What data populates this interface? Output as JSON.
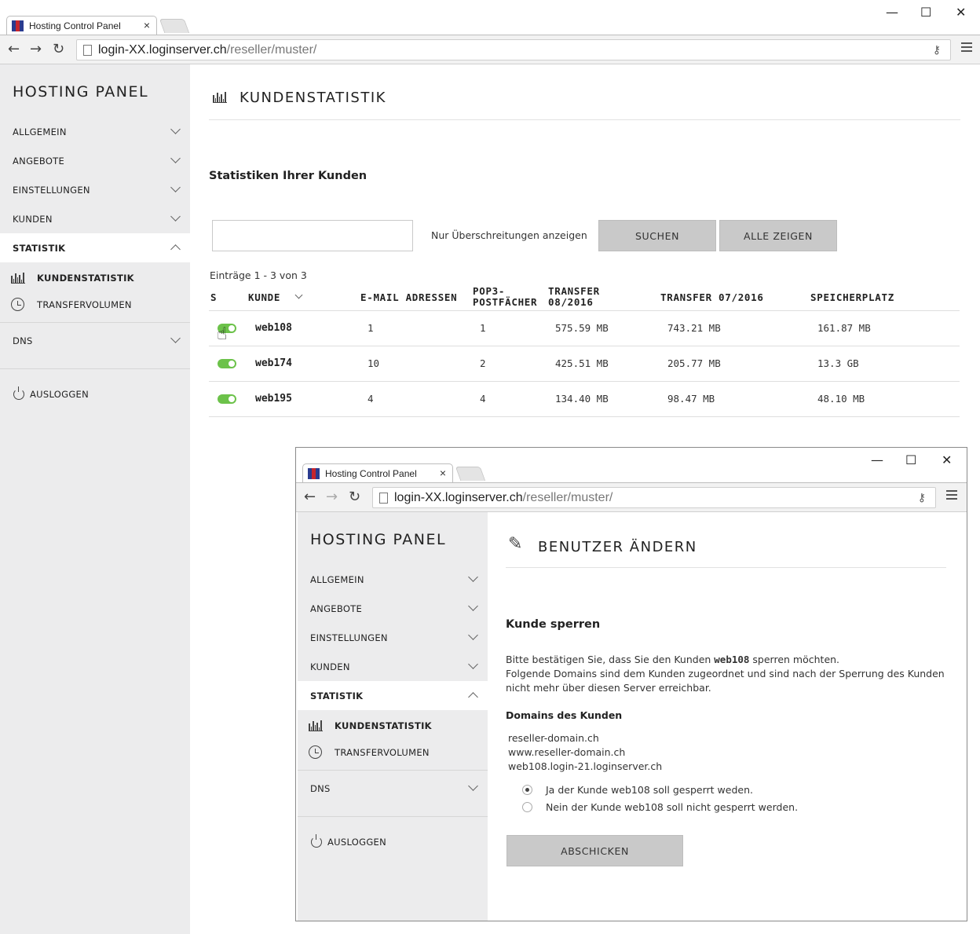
{
  "browser": {
    "tab_title": "Hosting Control Panel",
    "url_host": "login-XX.loginserver.ch",
    "url_path": "/reseller/muster/",
    "controls": {
      "minimize": "—",
      "maximize": "☐",
      "close": "✕"
    }
  },
  "sidebar": {
    "brand": "HOSTING PANEL",
    "items": [
      {
        "label": "ALLGEMEIN"
      },
      {
        "label": "ANGEBOTE"
      },
      {
        "label": "EINSTELLUNGEN"
      },
      {
        "label": "KUNDEN"
      },
      {
        "label": "STATISTIK"
      },
      {
        "label": "DNS"
      }
    ],
    "sub_items": [
      {
        "label": "KUNDENSTATISTIK",
        "icon": "bar-chart-icon"
      },
      {
        "label": "TRANSFERVOLUMEN",
        "icon": "clock-icon"
      }
    ],
    "logout": "AUSLOGGEN"
  },
  "main": {
    "title": "KUNDENSTATISTIK",
    "heading": "Statistiken Ihrer Kunden",
    "search_placeholder": "",
    "filter_label": "Nur Überschreitungen anzeigen",
    "search_button": "SUCHEN",
    "show_all_button": "ALLE ZEIGEN",
    "entries_info": "Einträge 1 - 3 von 3",
    "columns": {
      "s": "S",
      "kunde": "KUNDE",
      "email": "E-MAIL ADRESSEN",
      "pop3_line1": "POP3-",
      "pop3_line2": "POSTFÄCHER",
      "transfer_a_line1": "TRANSFER",
      "transfer_a_line2": "08/2016",
      "transfer_b": "TRANSFER 07/2016",
      "speicher": "SPEICHERPLATZ"
    },
    "rows": [
      {
        "kunde": "web108",
        "email": "1",
        "pop3": "1",
        "t0816": "575.59 MB",
        "t0716": "743.21 MB",
        "speicher": "161.87 MB"
      },
      {
        "kunde": "web174",
        "email": "10",
        "pop3": "2",
        "t0816": "425.51 MB",
        "t0716": "205.77 MB",
        "speicher": "13.3 GB"
      },
      {
        "kunde": "web195",
        "email": "4",
        "pop3": "4",
        "t0816": "134.40 MB",
        "t0716": "98.47 MB",
        "speicher": "48.10 MB"
      }
    ]
  },
  "dialog": {
    "title": "BENUTZER ÄNDERN",
    "heading": "Kunde sperren",
    "text_pre": "Bitte bestätigen Sie, dass Sie den Kunden ",
    "text_customer": "web108",
    "text_post": " sperren möchten.",
    "text_line2": "Folgende Domains sind dem Kunden zugeordnet und sind nach der Sperrung des Kunden",
    "text_line3": "nicht mehr über diesen Server erreichbar.",
    "domains_heading": "Domains des Kunden",
    "domains": [
      "reseller-domain.ch",
      "www.reseller-domain.ch",
      "web108.login-21.loginserver.ch"
    ],
    "option_yes": "Ja der Kunde web108 soll gesperrt weden.",
    "option_no": "Nein der Kunde web108 soll nicht gesperrt werden.",
    "submit": "ABSCHICKEN"
  }
}
